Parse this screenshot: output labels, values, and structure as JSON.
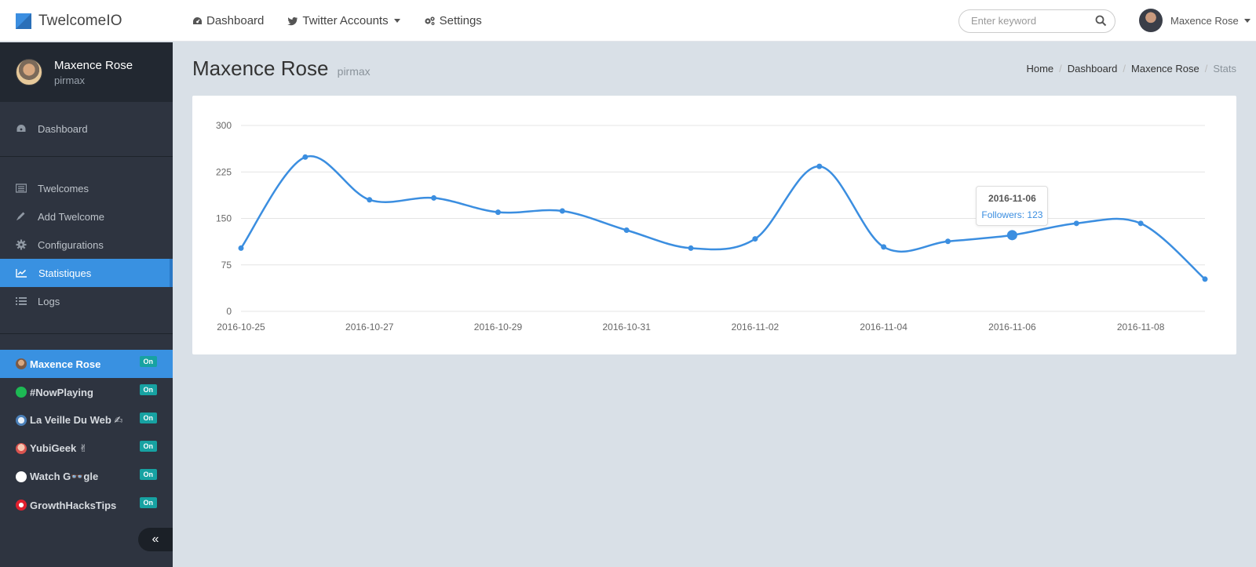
{
  "app": {
    "brand": "TwelcomeIO"
  },
  "nav": {
    "dashboard": "Dashboard",
    "twitter_accounts": "Twitter Accounts",
    "settings": "Settings"
  },
  "search": {
    "placeholder": "Enter keyword"
  },
  "user": {
    "name": "Maxence Rose",
    "handle": "pirmax"
  },
  "sidebar": {
    "items": [
      {
        "label": "Dashboard",
        "icon": "dashboard-icon"
      },
      {
        "label": "Twelcomes",
        "icon": "list-icon"
      },
      {
        "label": "Add Twelcome",
        "icon": "pencil-icon"
      },
      {
        "label": "Configurations",
        "icon": "gear-icon"
      },
      {
        "label": "Statistiques",
        "icon": "line-chart-icon",
        "active": true
      },
      {
        "label": "Logs",
        "icon": "logs-icon"
      }
    ],
    "accounts": [
      {
        "name": "Maxence Rose",
        "status": "On",
        "active": true
      },
      {
        "name": "#NowPlaying",
        "status": "On"
      },
      {
        "name": "La Veille Du Web ✍",
        "status": "On"
      },
      {
        "name": "YubiGeek ✌",
        "status": "On"
      },
      {
        "name": "Watch G👓gle",
        "status": "On"
      },
      {
        "name": "GrowthHacksTips",
        "status": "On"
      }
    ],
    "collapse": "«"
  },
  "page": {
    "title": "Maxence Rose",
    "subtitle": "pirmax"
  },
  "breadcrumb": [
    "Home",
    "Dashboard",
    "Maxence Rose",
    "Stats"
  ],
  "tooltip": {
    "date": "2016-11-06",
    "label": "Followers: 123"
  },
  "colors": {
    "accent": "#3991e1",
    "line": "#3b8ee0",
    "badge": "#17a2a2"
  },
  "chart_data": {
    "type": "line",
    "series": [
      {
        "name": "Followers",
        "values": [
          102,
          249,
          180,
          183,
          160,
          162,
          131,
          102,
          117,
          234,
          104,
          113,
          123,
          142,
          142,
          52
        ]
      }
    ],
    "x": [
      "2016-10-25",
      "2016-10-26",
      "2016-10-27",
      "2016-10-28",
      "2016-10-29",
      "2016-10-30",
      "2016-10-31",
      "2016-11-01",
      "2016-11-02",
      "2016-11-03",
      "2016-11-04",
      "2016-11-05",
      "2016-11-06",
      "2016-11-07",
      "2016-11-08",
      "2016-11-09"
    ],
    "x_tick_labels": [
      "2016-10-25",
      "2016-10-27",
      "2016-10-29",
      "2016-10-31",
      "2016-11-02",
      "2016-11-04",
      "2016-11-06",
      "2016-11-08"
    ],
    "y_ticks": [
      0,
      75,
      150,
      225,
      300
    ],
    "ylim": [
      0,
      300
    ],
    "grid": true,
    "highlight_index": 12
  }
}
